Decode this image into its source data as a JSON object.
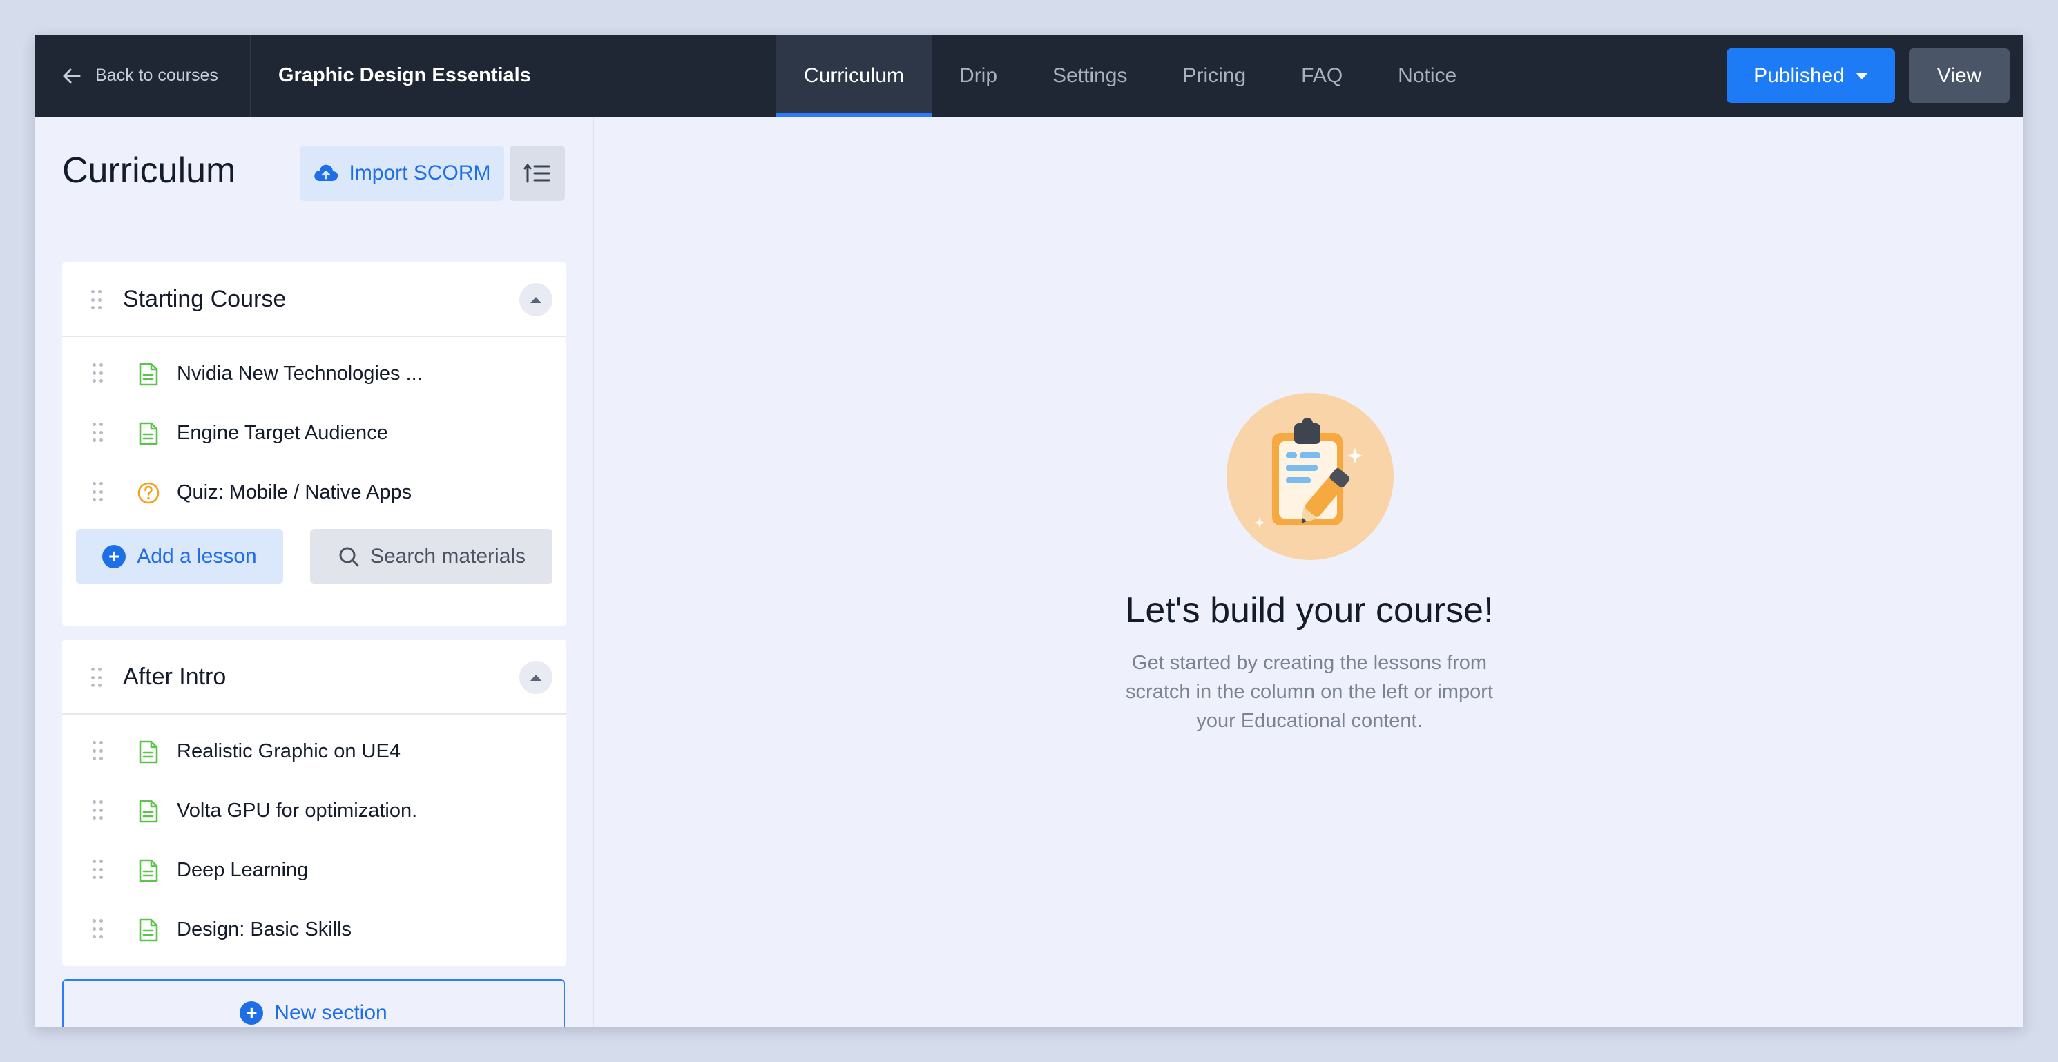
{
  "topbar": {
    "back_label": "Back to courses",
    "course_title": "Graphic Design Essentials",
    "tabs": [
      {
        "label": "Curriculum",
        "active": true
      },
      {
        "label": "Drip"
      },
      {
        "label": "Settings"
      },
      {
        "label": "Pricing"
      },
      {
        "label": "FAQ"
      },
      {
        "label": "Notice"
      }
    ],
    "status_label": "Published",
    "view_label": "View"
  },
  "sidebar": {
    "title": "Curriculum",
    "import_label": "Import SCORM",
    "sections": [
      {
        "title": "Starting Course",
        "lessons": [
          {
            "title": "Nvidia New Technologies ...",
            "icon": "document-icon"
          },
          {
            "title": "Engine Target Audience",
            "icon": "document-icon"
          },
          {
            "title": "Quiz: Mobile / Native Apps",
            "icon": "quiz-icon"
          }
        ],
        "add_lesson_label": "Add a lesson",
        "search_label": "Search materials"
      },
      {
        "title": "After Intro",
        "lessons": [
          {
            "title": "Realistic Graphic on UE4",
            "icon": "document-icon"
          },
          {
            "title": "Volta GPU for optimization.",
            "icon": "document-icon"
          },
          {
            "title": "Deep Learning",
            "icon": "document-icon"
          },
          {
            "title": "Design: Basic Skills",
            "icon": "document-icon"
          }
        ]
      }
    ],
    "new_section_label": "New section"
  },
  "main": {
    "empty_title": "Let's build your course!",
    "empty_description": "Get started by creating the lessons from scratch in the column on the left or import your Educational content."
  },
  "colors": {
    "accent": "#1e7bf6",
    "topbar": "#1f2734",
    "lesson_icon": "#5cc44a",
    "quiz_icon": "#f2a11e"
  }
}
